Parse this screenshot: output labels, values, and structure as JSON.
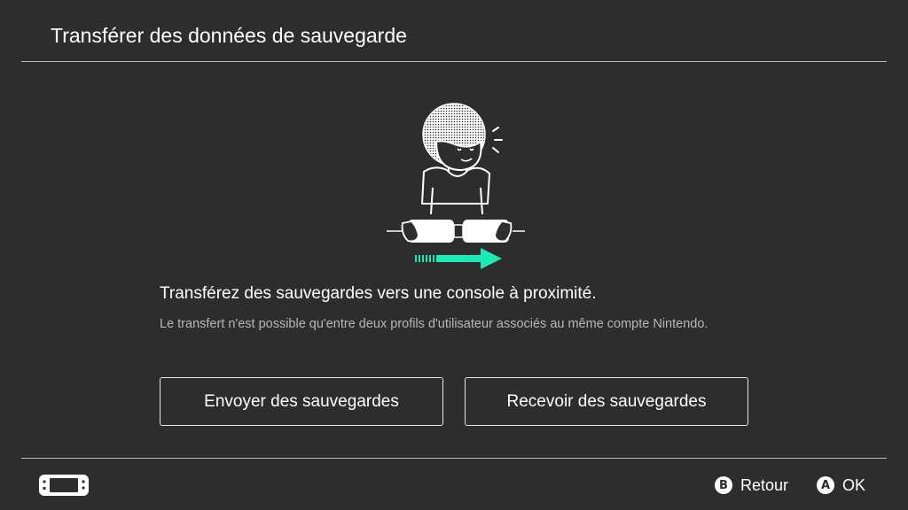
{
  "header": {
    "title": "Transférer des données de sauvegarde"
  },
  "content": {
    "main_text": "Transférez des sauvegardes vers une console à proximité.",
    "sub_text": "Le transfert n'est possible qu'entre deux profils d'utilisateur associés au même compte Nintendo."
  },
  "buttons": {
    "send_label": "Envoyer des sauvegardes",
    "receive_label": "Recevoir des sauvegardes"
  },
  "footer": {
    "console_icon": "handheld-console-icon",
    "back": {
      "glyph": "B",
      "label": "Retour"
    },
    "ok": {
      "glyph": "A",
      "label": "OK"
    }
  },
  "illustration": {
    "icon": "person-transferring-console-illustration",
    "arrow_color": "#1de9b6"
  },
  "colors": {
    "background": "#2d2d2d",
    "text": "#ffffff",
    "secondary_text": "#b8b8b8",
    "divider": "#bdbdbd",
    "accent": "#1de9b6"
  }
}
